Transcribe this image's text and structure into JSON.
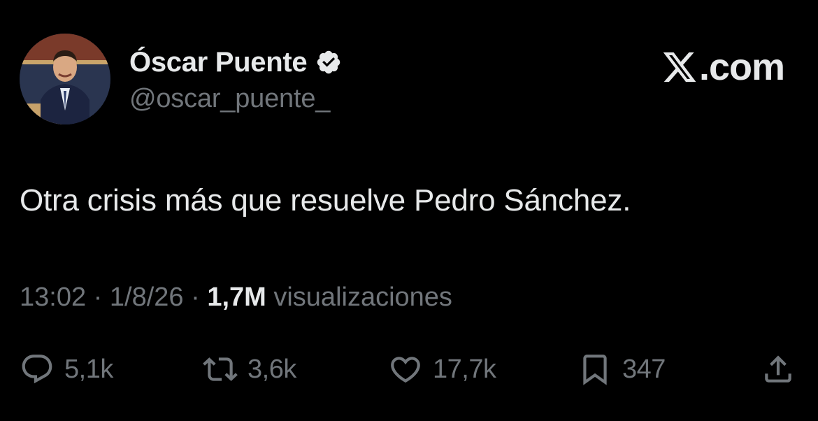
{
  "author": {
    "name": "Óscar Puente",
    "handle": "@oscar_puente_",
    "verified": true
  },
  "brand": {
    "label": ".com",
    "logo_icon": "x-logo-icon"
  },
  "tweet": {
    "text": "Otra crisis más que resuelve Pedro Sánchez.",
    "time": "13:02",
    "date": "1/8/26",
    "separator": "·",
    "views_count": "1,7M",
    "views_label": "visualizaciones"
  },
  "actions": {
    "replies": "5,1k",
    "retweets": "3,6k",
    "likes": "17,7k",
    "bookmarks": "347"
  },
  "colors": {
    "background": "#000000",
    "text": "#e7e9ea",
    "muted": "#71767b",
    "verified_badge": "#e7e9ea"
  }
}
